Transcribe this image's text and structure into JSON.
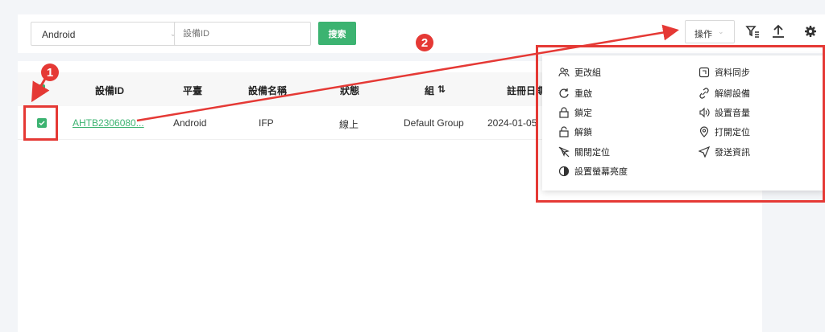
{
  "toolbar": {
    "platform_select": "Android",
    "device_id_placeholder": "設備ID",
    "search_label": "搜索",
    "operations_label": "操作"
  },
  "table": {
    "headers": [
      "設備ID",
      "平臺",
      "設備名稱",
      "狀態",
      "組",
      "註冊日期"
    ],
    "row": {
      "device_id": "AHTB2306080...",
      "platform": "Android",
      "device_name": "IFP",
      "status": "線上",
      "group": "Default Group",
      "register_date": "2024-01-05"
    }
  },
  "menu": {
    "left": [
      "更改組",
      "重啟",
      "鎖定",
      "解鎖",
      "關閉定位",
      "設置螢幕亮度"
    ],
    "right": [
      "資料同步",
      "解綁設備",
      "設置音量",
      "打開定位",
      "發送資訊"
    ]
  },
  "annotations": {
    "step1": "1",
    "step2": "2"
  },
  "colors": {
    "accent": "#3cb371",
    "annotation": "#e53935"
  }
}
